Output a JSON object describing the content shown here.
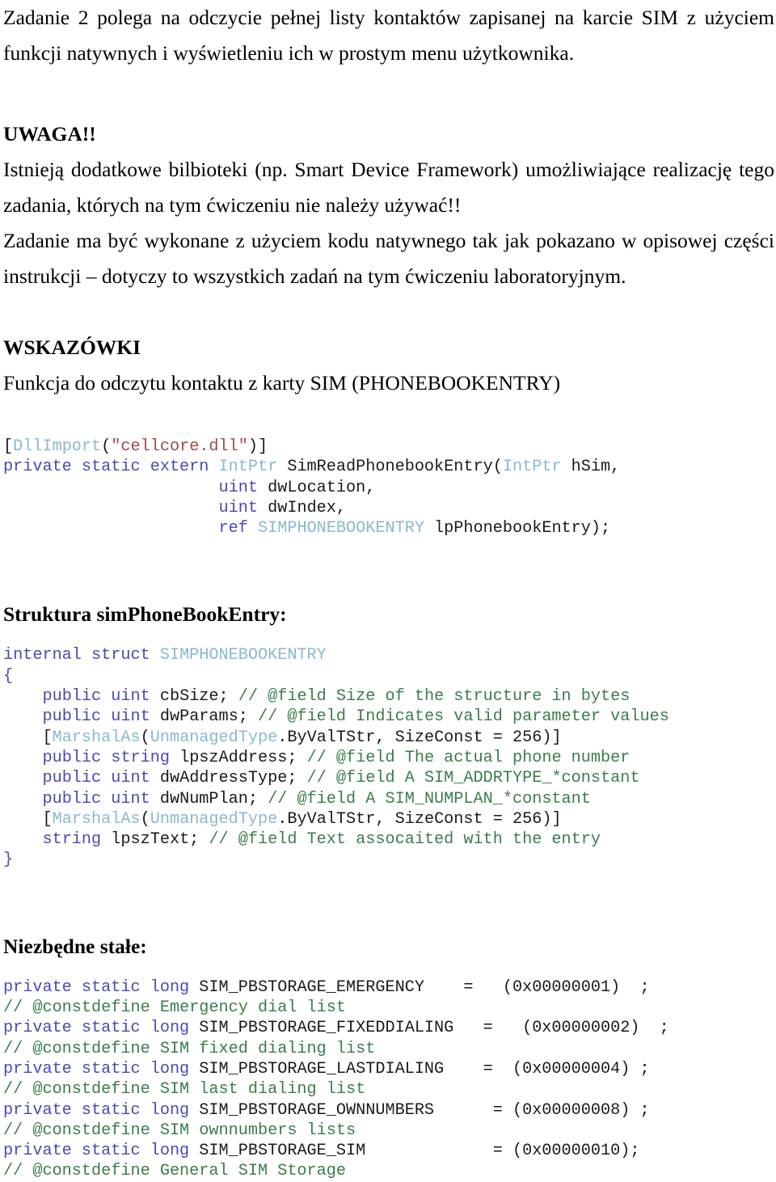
{
  "document": {
    "intro_paragraph": "Zadanie 2 polega na odczycie pełnej listy kontaktów zapisanej na karcie SIM z użyciem funkcji natywnych i wyświetleniu ich w prostym menu użytkownika.",
    "warning_heading": "UWAGA!!",
    "warning_paragraph_1": "Istnieją dodatkowe bilbioteki (np. Smart Device Framework) umożliwiające realizację tego zadania, których na tym ćwiczeniu nie należy używać!!",
    "warning_paragraph_2": "Zadanie ma być wykonane z użyciem kodu natywnego tak jak pokazano w opisowej części instrukcji – dotyczy to wszystkich zadań na tym ćwiczeniu laboratoryjnym.",
    "hints_heading": "WSKAZÓWKI",
    "hints_subtitle": "Funkcja do odczytu kontaktu z karty SIM (PHONEBOOKENTRY)",
    "struct_heading": "Struktura simPhoneBookEntry:",
    "constants_heading": "Niezbędne stałe:"
  },
  "code_blocks": {
    "dllimport": {
      "lines": [
        [
          {
            "t": "[",
            "c": "pl"
          },
          {
            "t": "DllImport",
            "c": "typ"
          },
          {
            "t": "(",
            "c": "pl"
          },
          {
            "t": "\"cellcore.dll\"",
            "c": "str"
          },
          {
            "t": ")]",
            "c": "pl"
          }
        ],
        [
          {
            "t": "private static extern ",
            "c": "kw"
          },
          {
            "t": "IntPtr",
            "c": "typ"
          },
          {
            "t": " SimReadPhonebookEntry(",
            "c": "pl"
          },
          {
            "t": "IntPtr",
            "c": "typ"
          },
          {
            "t": " hSim,",
            "c": "pl"
          }
        ],
        [
          {
            "t": "                      ",
            "c": "pl"
          },
          {
            "t": "uint",
            "c": "kw"
          },
          {
            "t": " dwLocation,",
            "c": "pl"
          }
        ],
        [
          {
            "t": "                      ",
            "c": "pl"
          },
          {
            "t": "uint",
            "c": "kw"
          },
          {
            "t": " dwIndex,",
            "c": "pl"
          }
        ],
        [
          {
            "t": "                      ",
            "c": "pl"
          },
          {
            "t": "ref",
            "c": "kw"
          },
          {
            "t": " ",
            "c": "pl"
          },
          {
            "t": "SIMPHONEBOOKENTRY",
            "c": "typ"
          },
          {
            "t": " lpPhonebookEntry);",
            "c": "pl"
          }
        ]
      ]
    },
    "struct": {
      "lines": [
        [
          {
            "t": "internal struct ",
            "c": "kw"
          },
          {
            "t": "SIMPHONEBOOKENTRY",
            "c": "typ"
          }
        ],
        [
          {
            "t": "{",
            "c": "pnc"
          }
        ],
        [
          {
            "t": "    ",
            "c": "pl"
          },
          {
            "t": "public uint",
            "c": "kw"
          },
          {
            "t": " cbSize; ",
            "c": "pl"
          },
          {
            "t": "// @field Size of the structure in bytes",
            "c": "cmt"
          }
        ],
        [
          {
            "t": "    ",
            "c": "pl"
          },
          {
            "t": "public uint",
            "c": "kw"
          },
          {
            "t": " dwParams; ",
            "c": "pl"
          },
          {
            "t": "// @field Indicates valid parameter values",
            "c": "cmt"
          }
        ],
        [
          {
            "t": "    [",
            "c": "pl"
          },
          {
            "t": "MarshalAs",
            "c": "typ"
          },
          {
            "t": "(",
            "c": "pl"
          },
          {
            "t": "UnmanagedType",
            "c": "typ"
          },
          {
            "t": ".ByValTStr, SizeConst = 256)]",
            "c": "pl"
          }
        ],
        [
          {
            "t": "    ",
            "c": "pl"
          },
          {
            "t": "public string",
            "c": "kw"
          },
          {
            "t": " lpszAddress; ",
            "c": "pl"
          },
          {
            "t": "// @field The actual phone number",
            "c": "cmt"
          }
        ],
        [
          {
            "t": "    ",
            "c": "pl"
          },
          {
            "t": "public uint",
            "c": "kw"
          },
          {
            "t": " dwAddressType; ",
            "c": "pl"
          },
          {
            "t": "// @field A SIM_ADDRTYPE_*constant",
            "c": "cmt"
          }
        ],
        [
          {
            "t": "    ",
            "c": "pl"
          },
          {
            "t": "public uint",
            "c": "kw"
          },
          {
            "t": " dwNumPlan; ",
            "c": "pl"
          },
          {
            "t": "// @field A SIM_NUMPLAN_*constant",
            "c": "cmt"
          }
        ],
        [
          {
            "t": "    [",
            "c": "pl"
          },
          {
            "t": "MarshalAs",
            "c": "typ"
          },
          {
            "t": "(",
            "c": "pl"
          },
          {
            "t": "UnmanagedType",
            "c": "typ"
          },
          {
            "t": ".ByValTStr, SizeConst = 256)]",
            "c": "pl"
          }
        ],
        [
          {
            "t": "    ",
            "c": "pl"
          },
          {
            "t": "string",
            "c": "kw"
          },
          {
            "t": " lpszText; ",
            "c": "pl"
          },
          {
            "t": "// @field Text assocaited with the entry",
            "c": "cmt"
          }
        ],
        [
          {
            "t": "}",
            "c": "pnc"
          }
        ]
      ]
    },
    "constants": {
      "lines": [
        [
          {
            "t": "private static long",
            "c": "kw"
          },
          {
            "t": " SIM_PBSTORAGE_EMERGENCY    =   (0x00000001)  ;",
            "c": "pl"
          }
        ],
        [
          {
            "t": "// @constdefine Emergency dial list",
            "c": "cmt"
          }
        ],
        [
          {
            "t": "private static long",
            "c": "kw"
          },
          {
            "t": " SIM_PBSTORAGE_FIXEDDIALING   =   (0x00000002)  ;",
            "c": "pl"
          }
        ],
        [
          {
            "t": "// @constdefine SIM fixed dialing list",
            "c": "cmt"
          }
        ],
        [
          {
            "t": "private static long",
            "c": "kw"
          },
          {
            "t": " SIM_PBSTORAGE_LASTDIALING    =  (0x00000004) ;",
            "c": "pl"
          }
        ],
        [
          {
            "t": "// @constdefine SIM last dialing list",
            "c": "cmt"
          }
        ],
        [
          {
            "t": "private static long",
            "c": "kw"
          },
          {
            "t": " SIM_PBSTORAGE_OWNNUMBERS      = (0x00000008) ;",
            "c": "pl"
          }
        ],
        [
          {
            "t": "// @constdefine SIM ownnumbers lists",
            "c": "cmt"
          }
        ],
        [
          {
            "t": "private static long",
            "c": "kw"
          },
          {
            "t": " SIM_PBSTORAGE_SIM             = (0x00000010);",
            "c": "pl"
          }
        ],
        [
          {
            "t": "// @constdefine General SIM Storage",
            "c": "cmt"
          }
        ]
      ]
    }
  },
  "colors": {
    "keyword": "#4a4ab4",
    "type": "#89b9cc",
    "string": "#9e4a4a",
    "comment": "#3a7d4a",
    "text": "#1a1a1a",
    "background": "#ffffff"
  }
}
